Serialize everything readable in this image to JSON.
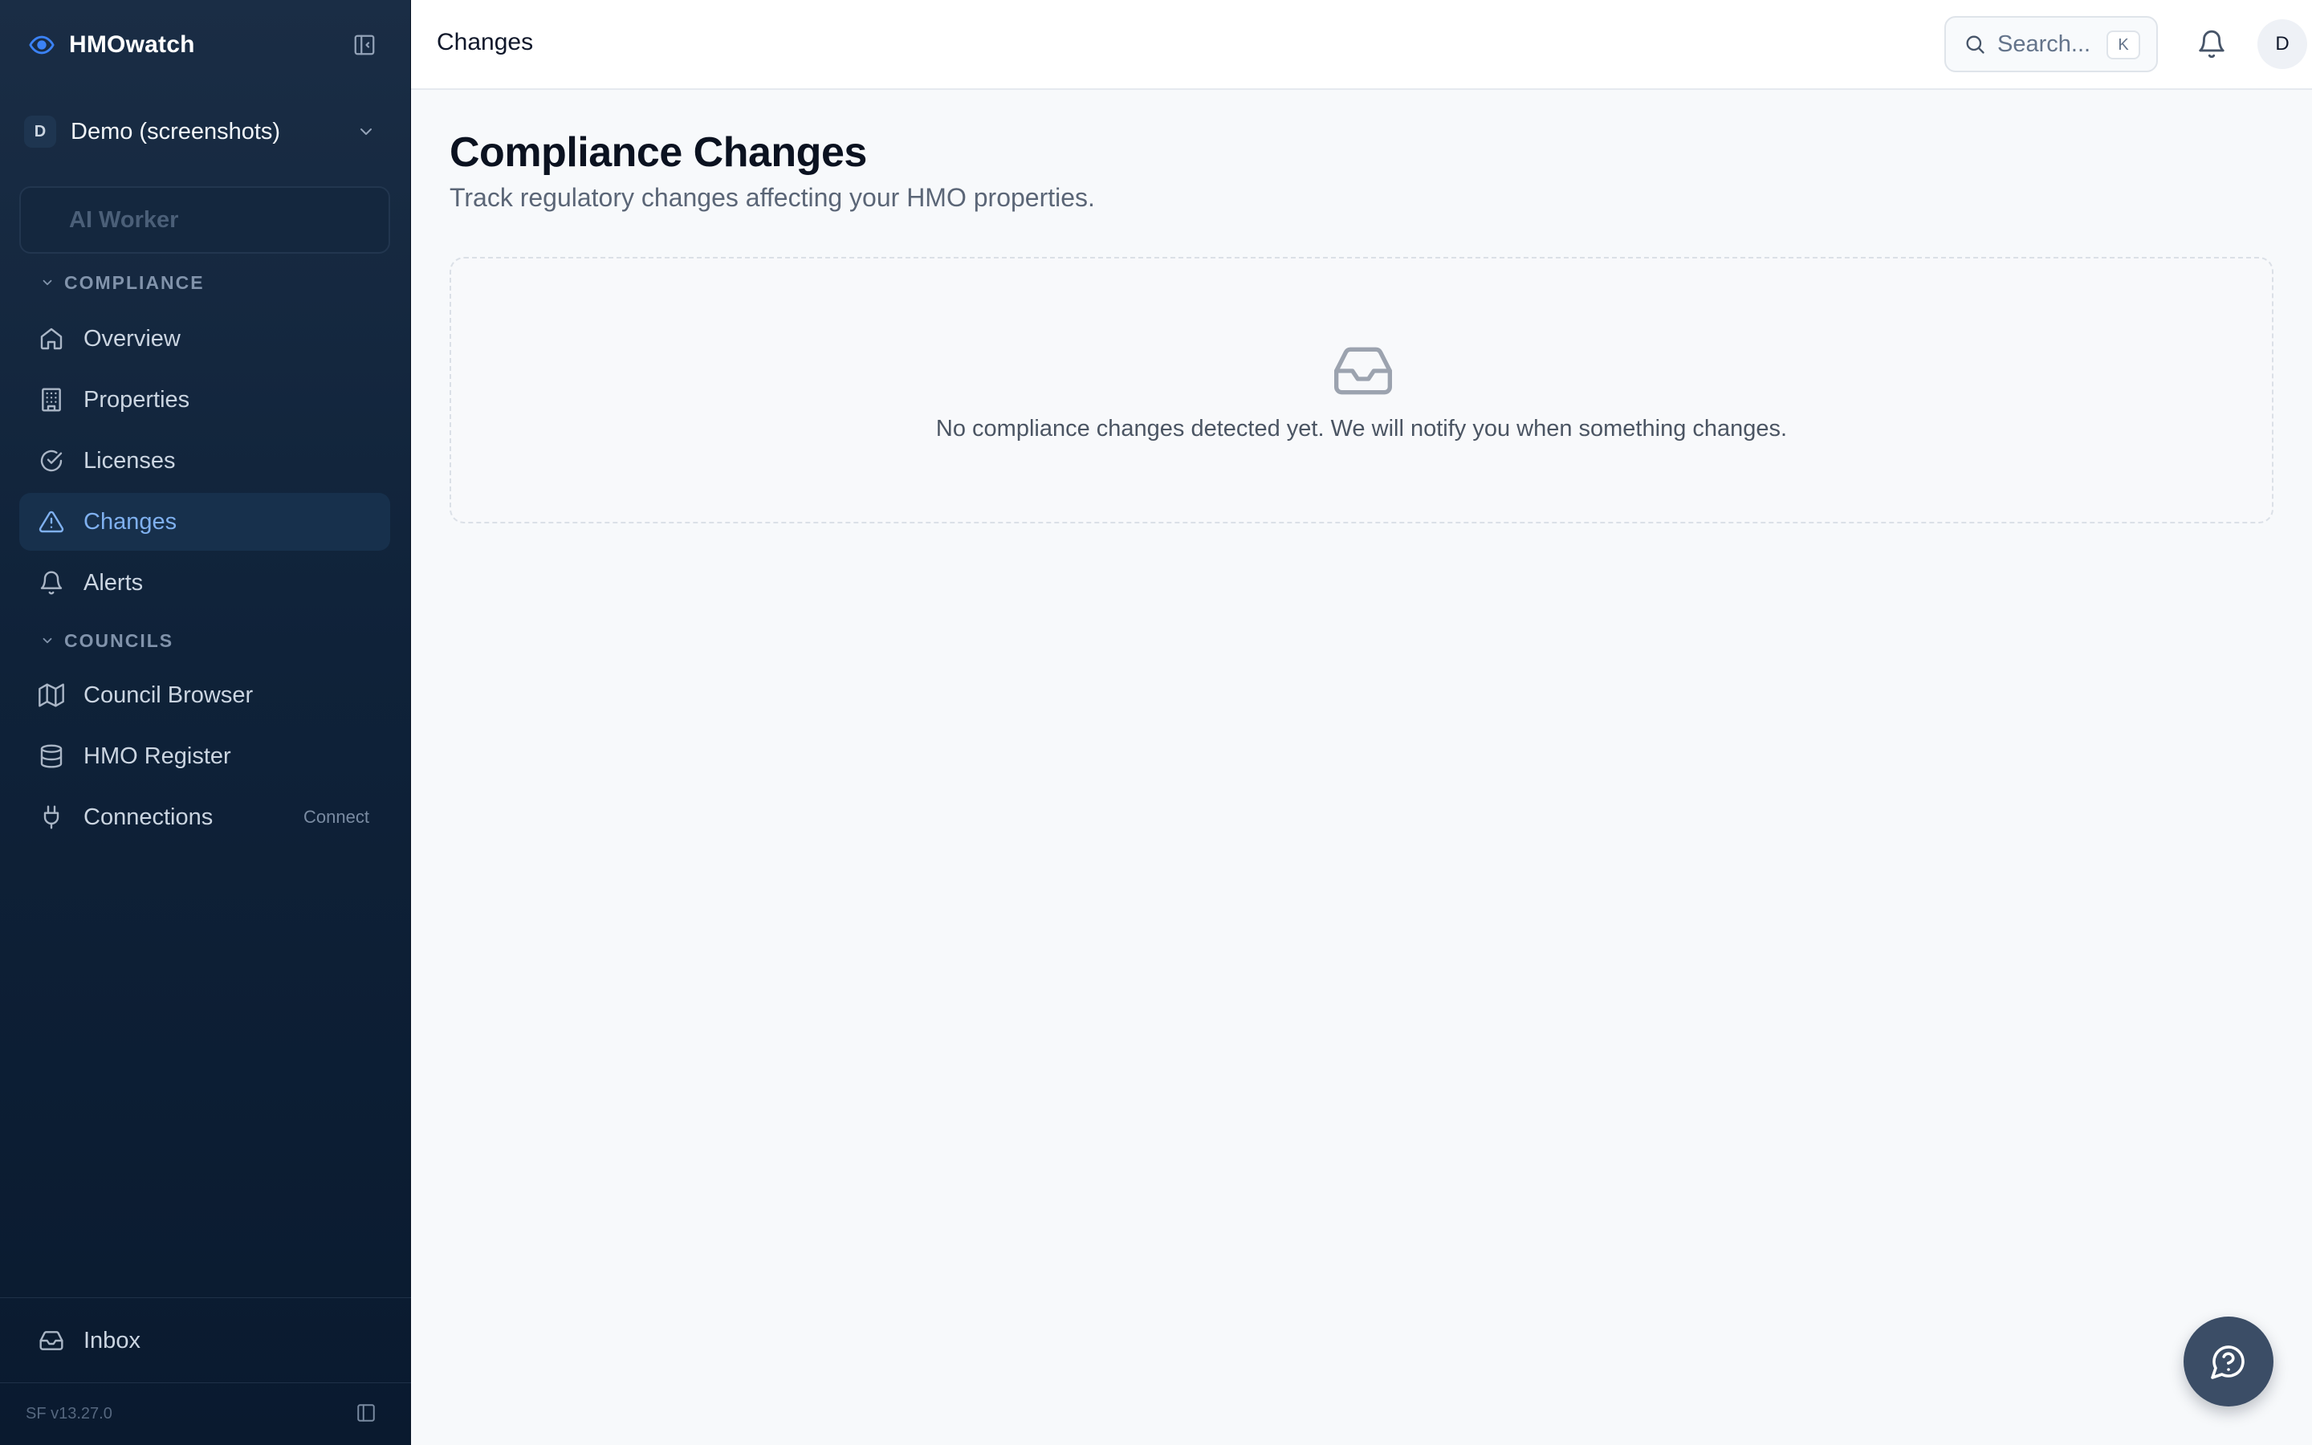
{
  "app": {
    "name": "HMOwatch"
  },
  "org": {
    "initial": "D",
    "name": "Demo (screenshots)"
  },
  "sidebar": {
    "ai_worker_label": "AI Worker",
    "sections": [
      {
        "label": "COMPLIANCE"
      },
      {
        "label": "COUNCILS"
      }
    ],
    "items": [
      {
        "label": "Overview",
        "icon": "home-icon"
      },
      {
        "label": "Properties",
        "icon": "building-icon"
      },
      {
        "label": "Licenses",
        "icon": "check-circle-icon"
      },
      {
        "label": "Changes",
        "icon": "alert-triangle-icon",
        "active": true
      },
      {
        "label": "Alerts",
        "icon": "bell-icon"
      },
      {
        "label": "Council Browser",
        "icon": "map-icon"
      },
      {
        "label": "HMO Register",
        "icon": "database-icon"
      },
      {
        "label": "Connections",
        "icon": "plug-icon",
        "badge": "Connect"
      }
    ],
    "inbox_label": "Inbox",
    "version": "SF v13.27.0"
  },
  "topbar": {
    "title": "Changes",
    "search_placeholder": "Search...",
    "search_shortcut": "K",
    "avatar_initial": "D"
  },
  "main": {
    "title": "Compliance Changes",
    "subtitle": "Track regulatory changes affecting your HMO properties.",
    "empty_message": "No compliance changes detected yet. We will notify you when something changes."
  },
  "colors": {
    "sidebar_bg": "#0f2239",
    "active_item_text": "#7fb0ef",
    "page_bg": "#f7f9fb",
    "help_fab_bg": "#3b4d66"
  }
}
